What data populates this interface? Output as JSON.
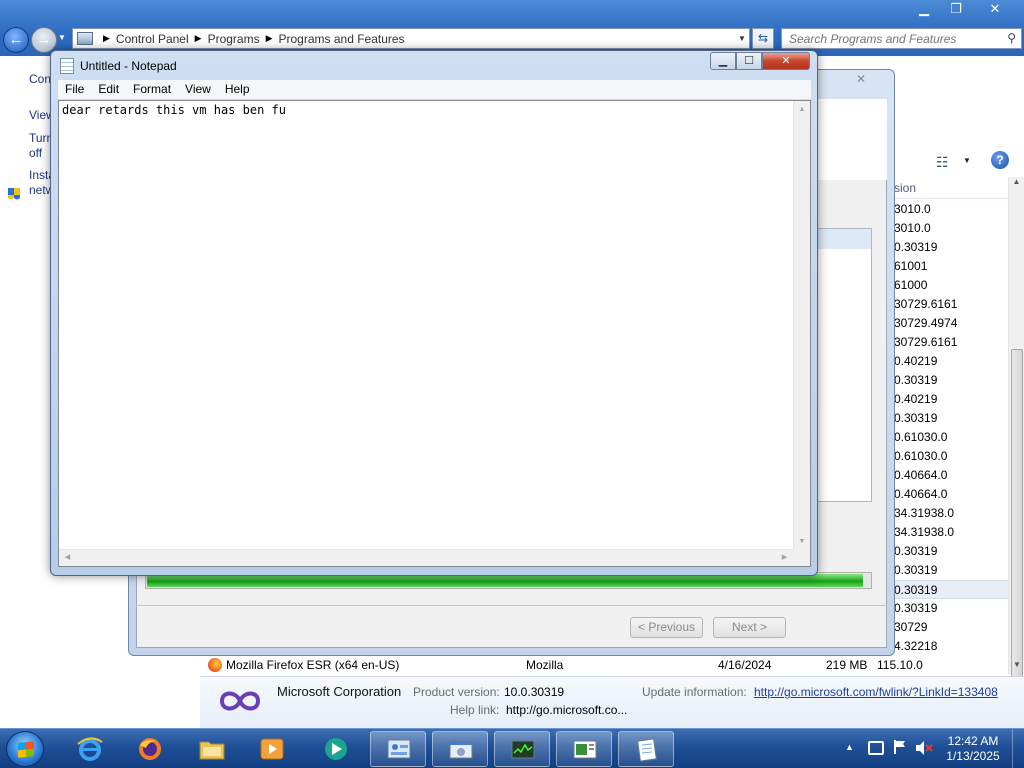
{
  "explorer": {
    "breadcrumb": [
      "Control Panel",
      "Programs",
      "Programs and Features"
    ],
    "search_placeholder": "Search Programs and Features",
    "left_pane": {
      "link_control_panel_home": "Con",
      "link_view_updates": "View",
      "link_turn_features": [
        "Turn",
        "off"
      ],
      "link_install_network": [
        "Insta",
        "netw"
      ]
    },
    "list": {
      "version_header": "sion",
      "versions": [
        "3010.0",
        "3010.0",
        "0.30319",
        "61001",
        "61000",
        "30729.6161",
        "30729.4974",
        "30729.6161",
        "0.40219",
        "0.30319",
        "0.40219",
        "0.30319",
        "0.61030.0",
        "0.61030.0",
        "0.40664.0",
        "0.40664.0",
        "34.31938.0",
        "34.31938.0",
        "0.30319",
        "0.30319",
        "0.30319",
        "0.30319",
        "30729",
        "4.32218"
      ],
      "selected_index": 20,
      "firefox_row": {
        "name": "Mozilla Firefox ESR (x64 en-US)",
        "publisher": "Mozilla",
        "installed_on": "4/16/2024",
        "size": "219 MB",
        "version": "115.10.0"
      }
    },
    "details": {
      "publisher": "Microsoft Corporation",
      "product_version_label": "Product version:",
      "product_version": "10.0.30319",
      "help_link_label": "Help link:",
      "help_link": "http://go.microsoft.co...",
      "update_info_label": "Update information:",
      "update_info_link": "http://go.microsoft.com/fwlink/?LinkId=133408"
    }
  },
  "wizard": {
    "progress_fraction": 0.99,
    "previous_label": "< Previous",
    "next_label": "Next >"
  },
  "notepad": {
    "title": "Untitled - Notepad",
    "menu": [
      "File",
      "Edit",
      "Format",
      "View",
      "Help"
    ],
    "content": "dear retards this vm has ben fu"
  },
  "taskbar": {
    "pinned": [
      "internet-explorer",
      "firefox",
      "windows-explorer",
      "media-player",
      "windows-live"
    ],
    "open": [
      "control-panel",
      "installer",
      "task-manager",
      "setup",
      "notepad"
    ],
    "time": "12:42 AM",
    "date": "1/13/2025"
  },
  "colors": {
    "accent": "#2d6bc0",
    "progress_green": "#16a016",
    "link_blue": "#1e3287"
  }
}
